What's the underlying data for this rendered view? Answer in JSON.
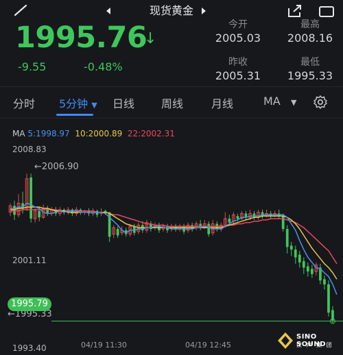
{
  "header": {
    "title": "现货黄金"
  },
  "quote": {
    "price": "1995.76",
    "arrow": "↓",
    "change": "-9.55",
    "change_pct": "-0.48%",
    "stats": [
      {
        "label": "今开",
        "value": "2005.03"
      },
      {
        "label": "最高",
        "value": "2008.16"
      },
      {
        "label": "昨收",
        "value": "2005.31"
      },
      {
        "label": "最低",
        "value": "1995.33"
      }
    ]
  },
  "tabs": [
    {
      "label": "分时"
    },
    {
      "label": "5分钟",
      "active": true
    },
    {
      "label": "日线"
    },
    {
      "label": "周线"
    },
    {
      "label": "月线"
    },
    {
      "label": "MA"
    }
  ],
  "ma_legend": {
    "title": "MA",
    "ma5": "5:1998.97",
    "ma10": "10:2000.89",
    "ma22": "22:2002.31"
  },
  "chart": {
    "y_top": "2008.83",
    "y_mid": "2001.11",
    "y_bottom": "1993.40",
    "high_marker": "2006.90",
    "low_marker": "1995.33",
    "current_tag": "1995.79",
    "time_labels": [
      "04/19 11:30",
      "04/19 12:45"
    ]
  },
  "chart_data": {
    "type": "candlestick",
    "ylim": [
      1993.4,
      2008.83
    ],
    "colors": {
      "up": "#e64a4a",
      "down": "#3fc75d",
      "ma5": "#4a92f0",
      "ma10": "#e8c748",
      "ma22": "#e64a62"
    },
    "candles": [
      [
        2003.9,
        2004.4,
        2004.6,
        2003.6
      ],
      [
        2004.4,
        2003.7,
        2004.8,
        2003.3
      ],
      [
        2003.7,
        2004.6,
        2005.3,
        2003.5
      ],
      [
        2004.6,
        2004.2,
        2005.5,
        2003.8
      ],
      [
        2004.2,
        2006.5,
        2006.9,
        2004.0
      ],
      [
        2006.6,
        2003.4,
        2006.9,
        2003.1
      ],
      [
        2003.4,
        2004.0,
        2004.2,
        2003.1
      ],
      [
        2004.0,
        2003.5,
        2004.3,
        2003.2
      ],
      [
        2003.5,
        2004.2,
        2004.5,
        2003.4
      ],
      [
        2004.2,
        2003.8,
        2004.4,
        2003.6
      ],
      [
        2003.8,
        2004.1,
        2004.3,
        2003.6
      ],
      [
        2004.1,
        2003.8,
        2004.3,
        2003.6
      ],
      [
        2003.8,
        2004.1,
        2004.3,
        2003.6
      ],
      [
        2004.1,
        2003.9,
        2004.2,
        2003.7
      ],
      [
        2003.9,
        2004.1,
        2004.3,
        2003.7
      ],
      [
        2004.1,
        2003.8,
        2004.2,
        2003.6
      ],
      [
        2003.8,
        2004.1,
        2004.3,
        2003.6
      ],
      [
        2004.1,
        2003.9,
        2004.2,
        2003.7
      ],
      [
        2003.9,
        2004.0,
        2004.1,
        2003.7
      ],
      [
        2004.0,
        2003.8,
        2004.2,
        2003.6
      ],
      [
        2003.8,
        2004.0,
        2004.2,
        2003.6
      ],
      [
        2004.0,
        2003.7,
        2004.1,
        2003.5
      ],
      [
        2003.8,
        2003.9,
        2004.2,
        2003.6
      ],
      [
        2004.0,
        2003.9,
        2004.1,
        2003.7
      ],
      [
        2003.9,
        2002.0,
        2003.9,
        2001.6
      ],
      [
        2002.2,
        2002.7,
        2002.9,
        2001.9
      ],
      [
        2002.6,
        2002.1,
        2002.8,
        2001.9
      ],
      [
        2002.3,
        2002.5,
        2002.8,
        2002.1
      ],
      [
        2002.5,
        2002.2,
        2002.7,
        2002.0
      ],
      [
        2002.2,
        2002.8,
        2003.0,
        2002.0
      ],
      [
        2002.8,
        2002.3,
        2003.0,
        2002.1
      ],
      [
        2002.4,
        2002.9,
        2003.1,
        2002.2
      ],
      [
        2002.9,
        2002.5,
        2003.2,
        2002.3
      ],
      [
        2002.5,
        2003.1,
        2003.3,
        2002.3
      ],
      [
        2003.0,
        2002.6,
        2003.2,
        2002.4
      ],
      [
        2002.7,
        2002.9,
        2003.1,
        2002.5
      ],
      [
        2002.9,
        2002.5,
        2003.1,
        2002.3
      ],
      [
        2002.6,
        2002.8,
        2003.0,
        2002.4
      ],
      [
        2002.8,
        2002.5,
        2003.0,
        2002.3
      ],
      [
        2002.6,
        2002.8,
        2003.0,
        2002.4
      ],
      [
        2002.8,
        2002.6,
        2003.0,
        2002.4
      ],
      [
        2002.6,
        2002.8,
        2003.0,
        2002.4
      ],
      [
        2002.8,
        2002.4,
        2003.0,
        2002.2
      ],
      [
        2002.5,
        2002.9,
        2003.1,
        2002.3
      ],
      [
        2002.9,
        2002.6,
        2003.1,
        2002.4
      ],
      [
        2002.7,
        2003.0,
        2003.2,
        2002.5
      ],
      [
        2003.0,
        2002.7,
        2003.3,
        2002.5
      ],
      [
        2002.8,
        2003.0,
        2003.3,
        2002.6
      ],
      [
        2003.0,
        2002.2,
        2003.2,
        2002.0
      ],
      [
        2002.3,
        2003.0,
        2003.3,
        2002.1
      ],
      [
        2003.0,
        2002.6,
        2003.2,
        2002.4
      ],
      [
        2002.6,
        2002.9,
        2003.1,
        2002.4
      ],
      [
        2002.9,
        2003.4,
        2003.9,
        2002.7
      ],
      [
        2003.4,
        2003.1,
        2003.7,
        2002.9
      ],
      [
        2003.2,
        2003.7,
        2003.9,
        2003.0
      ],
      [
        2003.6,
        2003.4,
        2003.8,
        2003.2
      ],
      [
        2003.4,
        2003.8,
        2004.0,
        2003.3
      ],
      [
        2003.8,
        2003.5,
        2004.0,
        2003.3
      ],
      [
        2003.5,
        2003.8,
        2004.1,
        2003.3
      ],
      [
        2003.8,
        2003.5,
        2004.0,
        2003.3
      ],
      [
        2003.5,
        2003.9,
        2004.1,
        2003.3
      ],
      [
        2003.9,
        2003.6,
        2004.1,
        2003.4
      ],
      [
        2003.6,
        2003.8,
        2004.1,
        2003.5
      ],
      [
        2003.8,
        2003.6,
        2004.0,
        2003.4
      ],
      [
        2003.6,
        2003.8,
        2004.0,
        2003.5
      ],
      [
        2003.8,
        2003.6,
        2004.1,
        2003.4
      ],
      [
        2003.6,
        2002.6,
        2003.8,
        2002.4
      ],
      [
        2002.6,
        2001.2,
        2002.9,
        2000.7
      ],
      [
        2001.3,
        2001.0,
        2001.6,
        2000.5
      ],
      [
        2001.0,
        2000.4,
        2001.3,
        1999.9
      ],
      [
        2000.6,
        2000.0,
        2000.9,
        1999.6
      ],
      [
        2000.1,
        1999.6,
        2000.4,
        1999.1
      ],
      [
        1999.7,
        1999.3,
        2000.0,
        1998.9
      ],
      [
        1999.5,
        1999.1,
        1999.8,
        1998.8
      ],
      [
        1999.3,
        1999.8,
        2000.0,
        1999.0
      ],
      [
        1999.6,
        1998.6,
        1999.9,
        1998.3
      ],
      [
        1998.7,
        1998.3,
        1999.0,
        1997.9
      ],
      [
        1998.3,
        1996.1,
        1998.6,
        1995.8
      ],
      [
        1996.3,
        1995.5,
        1996.6,
        1995.3
      ]
    ],
    "ma5": [
      2004.2,
      2004.2,
      2004.3,
      2004.3,
      2004.6,
      2004.5,
      2004.3,
      2004.2,
      2003.9,
      2003.8,
      2003.8,
      2003.9,
      2004.0,
      2003.9,
      2004.0,
      2004.0,
      2004.0,
      2003.9,
      2003.9,
      2003.9,
      2003.9,
      2003.9,
      2003.9,
      2003.8,
      2003.5,
      2003.2,
      2002.9,
      2002.5,
      2002.3,
      2002.5,
      2002.5,
      2002.6,
      2002.6,
      2002.7,
      2002.7,
      2002.8,
      2002.8,
      2002.7,
      2002.7,
      2002.6,
      2002.6,
      2002.6,
      2002.6,
      2002.6,
      2002.6,
      2002.7,
      2002.7,
      2002.8,
      2002.7,
      2002.6,
      2002.6,
      2002.6,
      2002.8,
      2003.0,
      2003.2,
      2003.3,
      2003.5,
      2003.5,
      2003.6,
      2003.6,
      2003.6,
      2003.7,
      2003.7,
      2003.7,
      2003.7,
      2003.7,
      2003.7,
      2003.5,
      2003.0,
      2002.5,
      2001.7,
      2001.0,
      2000.4,
      2000.0,
      1999.6,
      1999.5,
      1999.2,
      1998.9,
      1998.3,
      1997.5
    ],
    "ma10": [
      2004.1,
      2004.1,
      2004.2,
      2004.2,
      2004.3,
      2004.3,
      2004.3,
      2004.3,
      2004.2,
      2004.2,
      2004.1,
      2004.0,
      2004.0,
      2004.0,
      2003.9,
      2003.9,
      2003.9,
      2003.9,
      2003.9,
      2003.9,
      2003.9,
      2003.9,
      2003.9,
      2003.9,
      2003.8,
      2003.6,
      2003.4,
      2003.2,
      2003.0,
      2002.9,
      2002.8,
      2002.7,
      2002.7,
      2002.7,
      2002.7,
      2002.7,
      2002.7,
      2002.7,
      2002.7,
      2002.7,
      2002.7,
      2002.7,
      2002.7,
      2002.7,
      2002.7,
      2002.7,
      2002.7,
      2002.7,
      2002.7,
      2002.7,
      2002.7,
      2002.7,
      2002.8,
      2002.9,
      2003.0,
      2003.1,
      2003.2,
      2003.3,
      2003.4,
      2003.5,
      2003.5,
      2003.6,
      2003.6,
      2003.6,
      2003.6,
      2003.6,
      2003.6,
      2003.5,
      2003.3,
      2003.0,
      2002.6,
      2002.1,
      2001.6,
      2001.1,
      2000.7,
      2000.3,
      1999.9,
      1999.6,
      1999.2,
      1998.7
    ],
    "ma22": [
      2004.0,
      2004.0,
      2004.0,
      2004.1,
      2004.1,
      2004.1,
      2004.1,
      2004.1,
      2004.1,
      2004.1,
      2004.1,
      2004.1,
      2004.0,
      2004.0,
      2004.0,
      2004.0,
      2004.0,
      2004.0,
      2004.0,
      2004.0,
      2004.0,
      2003.9,
      2003.9,
      2003.9,
      2003.8,
      2003.7,
      2003.7,
      2003.6,
      2003.5,
      2003.4,
      2003.3,
      2003.2,
      2003.1,
      2003.0,
      2003.0,
      2002.9,
      2002.9,
      2002.9,
      2002.8,
      2002.8,
      2002.8,
      2002.8,
      2002.8,
      2002.8,
      2002.8,
      2002.8,
      2002.8,
      2002.8,
      2002.8,
      2002.8,
      2002.8,
      2002.8,
      2002.8,
      2002.9,
      2002.9,
      2003.0,
      2003.0,
      2003.1,
      2003.1,
      2003.2,
      2003.2,
      2003.3,
      2003.3,
      2003.4,
      2003.4,
      2003.4,
      2003.4,
      2003.3,
      2003.2,
      2003.1,
      2002.9,
      2002.7,
      2002.4,
      2002.1,
      2001.8,
      2001.5,
      2001.2,
      2000.9,
      2000.4,
      1999.9
    ]
  }
}
